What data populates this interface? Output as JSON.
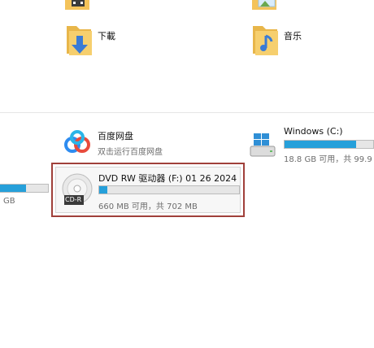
{
  "folders": [
    {
      "name": "下載",
      "icon": "download-folder-icon"
    },
    {
      "name": "音乐",
      "icon": "music-folder-icon"
    }
  ],
  "devices": {
    "left_partial": {
      "size_suffix": "GB",
      "used_fraction": 0.55
    },
    "baidu": {
      "name": "百度网盘",
      "subtitle": "双击运行百度网盘",
      "icon": "baidu-netdisk-icon"
    },
    "windows_c": {
      "name": "Windows (C:)",
      "free_text": "18.8 GB 可用，共 99.9",
      "used_fraction": 0.81,
      "icon": "windows-drive-icon"
    },
    "dvd": {
      "name": "DVD RW 驱动器 (F:) 01 26 2024",
      "free_text": "660 MB 可用，共 702 MB",
      "used_fraction": 0.06,
      "disc_badge": "CD-R",
      "icon": "cd-disc-icon"
    }
  },
  "colors": {
    "bar_fill": "#26a0da",
    "bar_track": "#e6e6e6",
    "highlight_border": "#a0403a",
    "folder_yellow": "#f4c35a"
  }
}
